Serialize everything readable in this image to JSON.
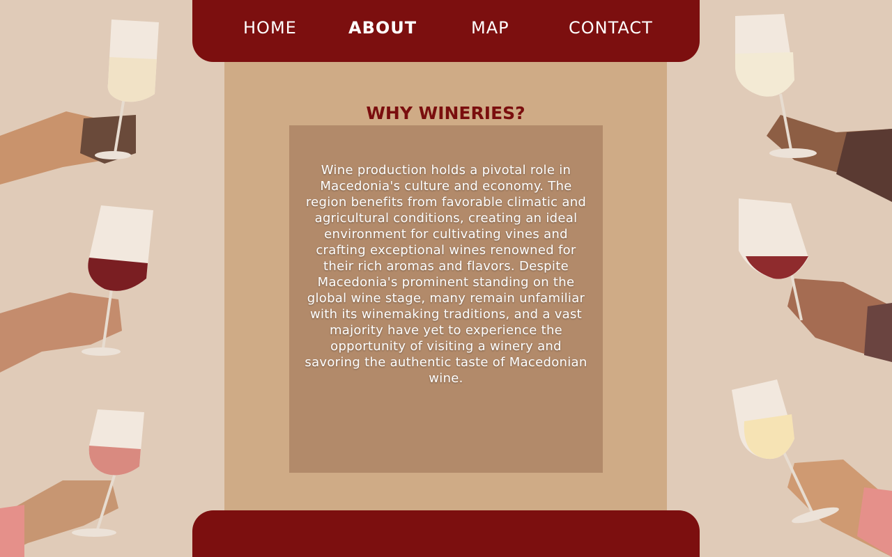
{
  "nav": {
    "items": [
      {
        "label": "HOME",
        "active": false
      },
      {
        "label": "ABOUT",
        "active": true
      },
      {
        "label": "MAP",
        "active": false
      },
      {
        "label": "CONTACT",
        "active": false
      }
    ]
  },
  "main": {
    "heading": "WHY WINERIES?",
    "body": "Wine production holds a pivotal role in Macedonia's culture and economy. The region benefits from favorable climatic and agricultural conditions, creating an ideal environment for cultivating vines and crafting exceptional wines renowned for their rich aromas and flavors. Despite Macedonia's prominent standing on the global wine stage, many remain unfamiliar with its winemaking traditions, and a vast majority have yet to experience the opportunity of visiting a winery and savoring the authentic taste of Macedonian wine."
  },
  "decorations": [
    {
      "icon": "white-wine-glass-hand-icon",
      "wine_color": "#f1e2c6"
    },
    {
      "icon": "red-wine-glass-hand-icon",
      "wine_color": "#7a1e22"
    },
    {
      "icon": "rose-wine-glass-hand-icon",
      "wine_color": "#d98a80"
    },
    {
      "icon": "white-wine-glass-hand-icon",
      "wine_color": "#f3ead4"
    },
    {
      "icon": "red-wine-glass-hand-icon",
      "wine_color": "#8f2b2d"
    },
    {
      "icon": "white-wine-glass-hand-icon",
      "wine_color": "#f6e3b4"
    }
  ],
  "colors": {
    "background": "#e0cbb8",
    "nav": "#7c0f0f",
    "panel": "#cfab86",
    "textbox": "#b28a6a",
    "heading": "#7a0e0e"
  }
}
